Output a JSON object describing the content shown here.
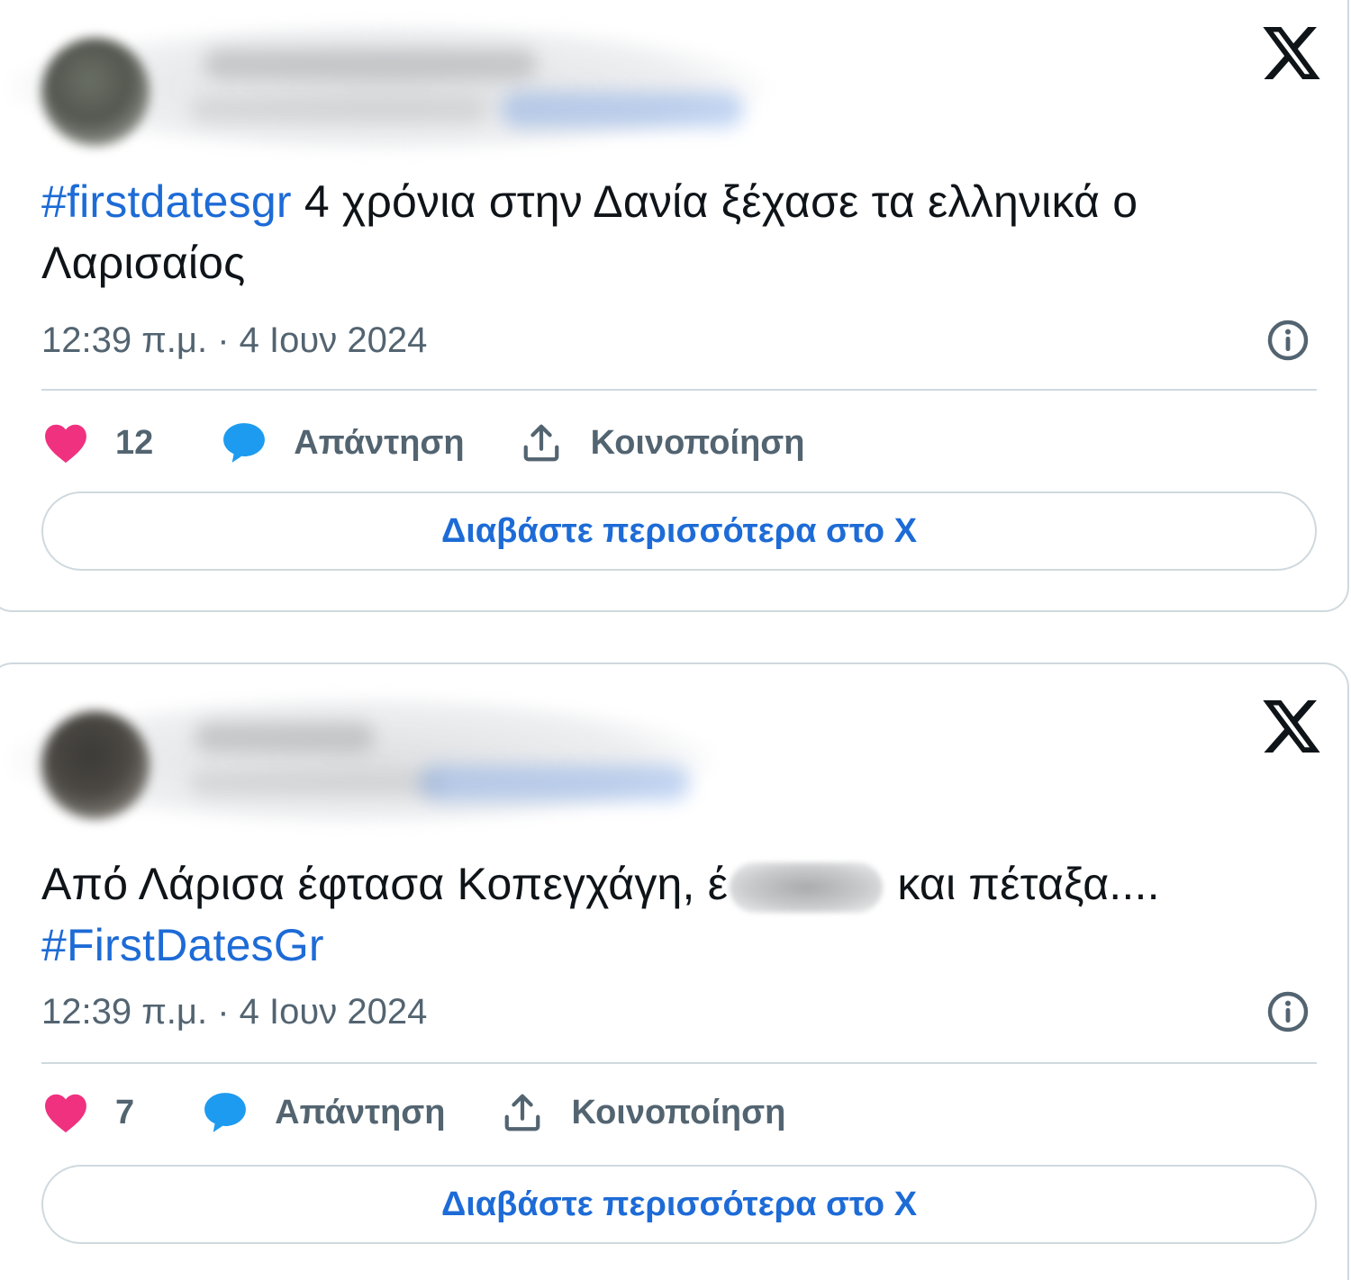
{
  "tweets": [
    {
      "hashtag": "#firstdatesgr",
      "text_before": "",
      "text_after": " 4 χρόνια στην Δανία ξέχασε τα ελληνικά ο Λαρισαίος",
      "text_redacted_before": "",
      "text_redacted_after": "",
      "timestamp": "12:39 π.μ. · 4 Ιουν 2024",
      "likes": "12",
      "reply_label": "Απάντηση",
      "share_label": "Κοινοποίηση",
      "read_more": "Διαβάστε περισσότερα στο X"
    },
    {
      "text_redacted_before": "Από Λάρισα έφτασα Κοπεγχάγη, έ",
      "text_redacted_after": " και πέταξα....",
      "hashtag": "#FirstDatesGr",
      "timestamp": "12:39 π.μ. · 4 Ιουν 2024",
      "likes": "7",
      "reply_label": "Απάντηση",
      "share_label": "Κοινοποίηση",
      "read_more": "Διαβάστε περισσότερα στο X"
    }
  ],
  "colors": {
    "link": "#1d6bd6",
    "like": "#f0317f",
    "reply": "#1d9bf0",
    "muted": "#536471",
    "border": "#cfd9de"
  },
  "icons": [
    "x-logo-icon",
    "info-icon",
    "heart-icon",
    "reply-bubble-icon",
    "share-icon"
  ]
}
